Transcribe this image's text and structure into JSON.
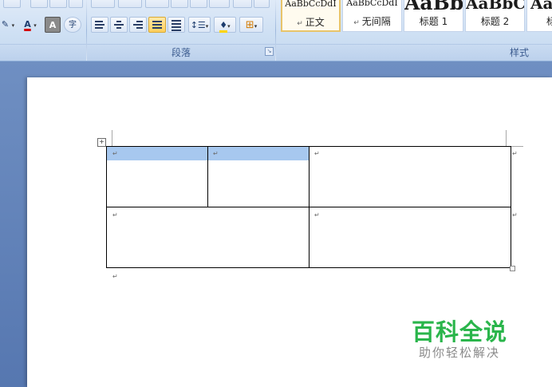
{
  "ribbon": {
    "font_group": {
      "font_color_label": "A",
      "char_shading_label": "A",
      "enclose_char_label": "字"
    },
    "paragraph_group": {
      "label": "段落"
    },
    "styles_group": {
      "label": "样式",
      "items": [
        {
          "sample": "AaBbCcDdI",
          "name": "正文",
          "selected": true
        },
        {
          "sample": "AaBbCcDdI",
          "name": "无间隔",
          "selected": false
        },
        {
          "sample": "AaBb",
          "name": "标题 1",
          "selected": false
        },
        {
          "sample": "AaBbC",
          "name": "标题 2",
          "selected": false
        },
        {
          "sample": "Aa",
          "name": "标",
          "selected": false
        }
      ]
    }
  },
  "document": {
    "paragraph_mark": "↵",
    "table_handle": "+"
  },
  "watermark": {
    "title": "百科全说",
    "subtitle": "助你轻松解决"
  },
  "colors": {
    "selection": "#a7c8ef",
    "watermark_green": "#2ab54b",
    "ribbon_bg": "#cddff3"
  }
}
